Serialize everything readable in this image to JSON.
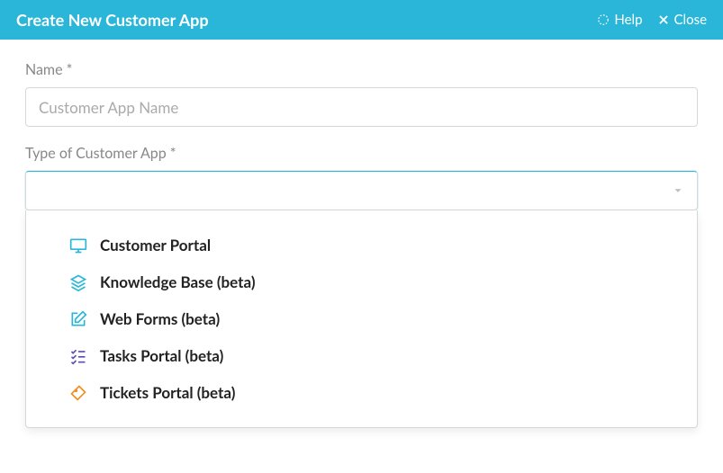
{
  "header": {
    "title": "Create New Customer App",
    "help_label": "Help",
    "close_label": "Close"
  },
  "form": {
    "name_label": "Name *",
    "name_placeholder": "Customer App Name",
    "type_label": "Type of Customer App *"
  },
  "options": [
    {
      "icon": "monitor-icon",
      "color": "#29b6d8",
      "label": "Customer Portal"
    },
    {
      "icon": "layers-icon",
      "color": "#29b6d8",
      "label": "Knowledge Base (beta)"
    },
    {
      "icon": "edit-icon",
      "color": "#29b6d8",
      "label": "Web Forms (beta)"
    },
    {
      "icon": "checklist-icon",
      "color": "#5e4fb3",
      "label": "Tasks Portal (beta)"
    },
    {
      "icon": "ticket-icon",
      "color": "#f28c1e",
      "label": "Tickets Portal (beta)"
    }
  ]
}
